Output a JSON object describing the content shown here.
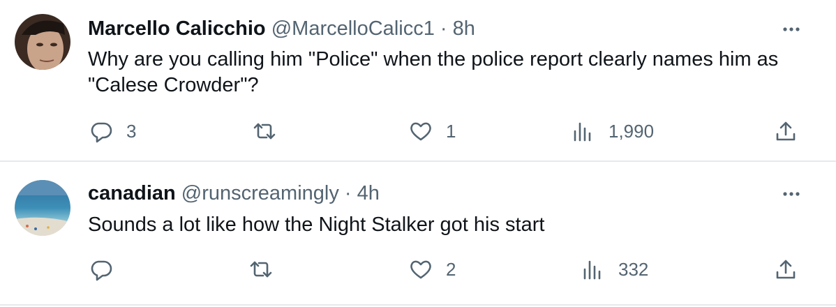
{
  "tweets": [
    {
      "author_name": "Marcello Calicchio",
      "handle": "@MarcelloCalicc1",
      "separator": "·",
      "time": "8h",
      "text": "Why are you calling him \"Police\" when the police report clearly names him as \"Calese Crowder\"?",
      "replies": "3",
      "retweets": "",
      "likes": "1",
      "views": "1,990"
    },
    {
      "author_name": "canadian",
      "handle": "@runscreamingly",
      "separator": "·",
      "time": "4h",
      "text": "Sounds a lot like how the Night Stalker got his start",
      "replies": "",
      "retweets": "",
      "likes": "2",
      "views": "332"
    }
  ],
  "icons": {
    "reply": "reply-icon",
    "retweet": "retweet-icon",
    "like": "heart-icon",
    "views": "views-icon",
    "share": "share-icon",
    "more": "more-icon"
  },
  "colors": {
    "text": "#0f1419",
    "secondary": "#536471",
    "divider": "#e6e9eb"
  }
}
